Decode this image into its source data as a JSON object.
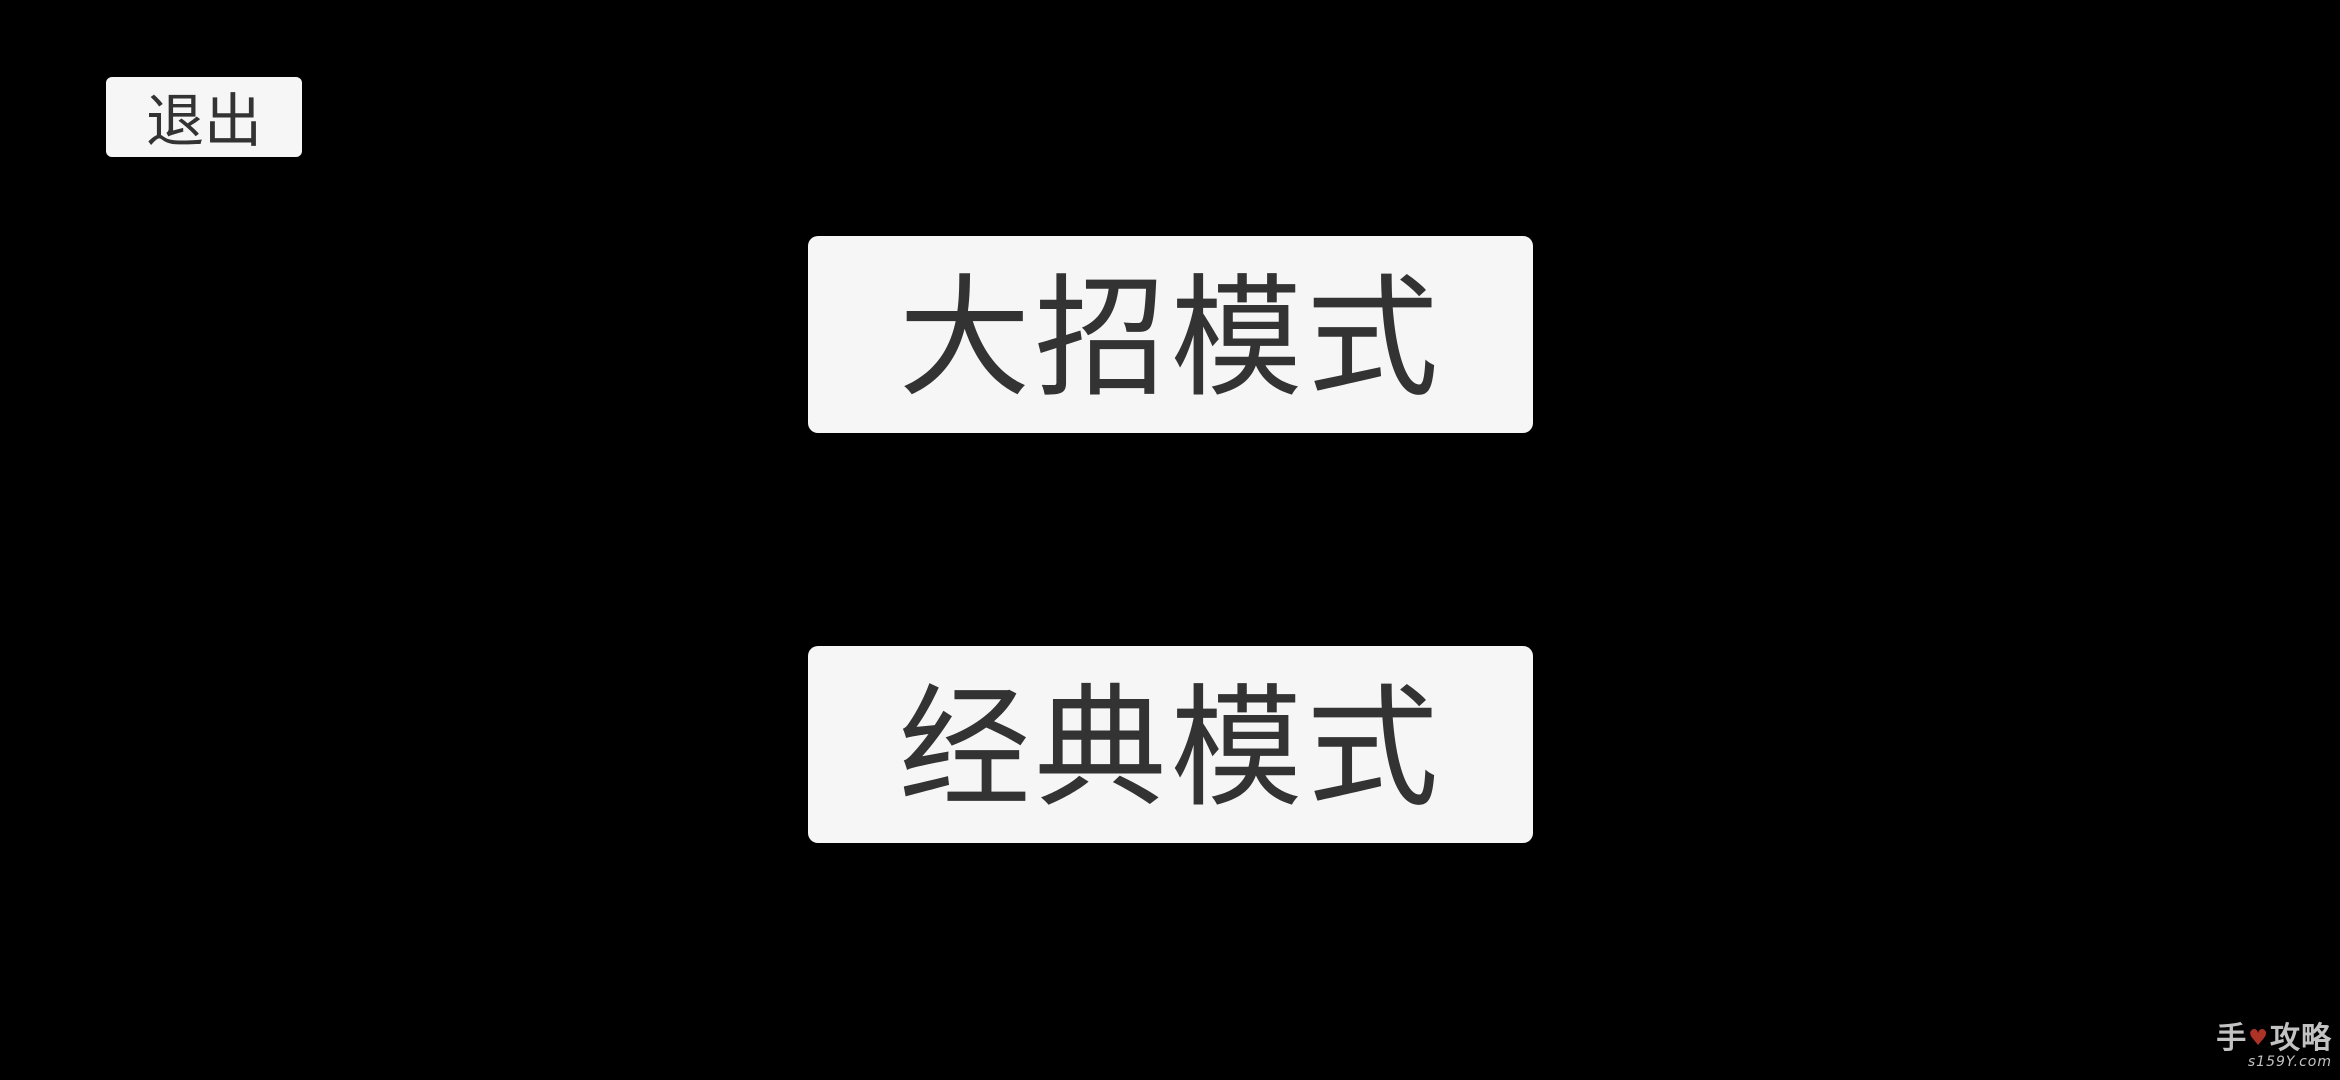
{
  "screen": {
    "background_color": "#000000"
  },
  "exit_button": {
    "label": "退出"
  },
  "mode_buttons": [
    {
      "label": "大招模式"
    },
    {
      "label": "经典模式"
    }
  ],
  "watermark": {
    "logo_text_left": "手",
    "logo_icon": "heart-icon",
    "logo_text_right": "攻略",
    "url": "s159Y.com"
  },
  "colors": {
    "button_bg": "#f6f6f6",
    "button_text": "#333333"
  }
}
